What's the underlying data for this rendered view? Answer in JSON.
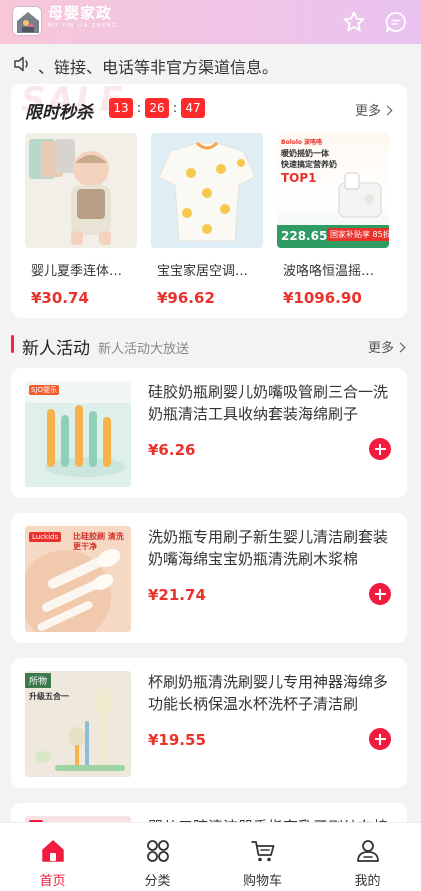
{
  "header": {
    "brand_cn": "母婴家政",
    "brand_pinyin": "MU YIN JIA ZHENG",
    "icons": [
      "star-icon",
      "message-icon"
    ]
  },
  "notice": {
    "text": "、链接、电话等非官方渠道信息。"
  },
  "flash_sale": {
    "title": "限时秒杀",
    "watermark": "SALE",
    "countdown": {
      "hours": "13",
      "minutes": "26",
      "seconds": "47"
    },
    "more_label": "更多",
    "items": [
      {
        "name": "婴儿夏季连体…",
        "price": "¥30.74"
      },
      {
        "name": "宝宝家居空调…",
        "price": "¥96.62"
      },
      {
        "name": "波咯咯恒温摇…",
        "price": "¥1096.90"
      }
    ],
    "item3_banner": {
      "brand": "Bololo 波咯咯",
      "line1": "暖奶摇奶一体",
      "line2": "快速搞定营养奶",
      "badge": "TOP1",
      "promo_price": "228.65",
      "subsidy": "国家补贴享 85折"
    }
  },
  "section": {
    "title": "新人活动",
    "subtitle": "新人活动大放送",
    "more_label": "更多"
  },
  "products": [
    {
      "title": "硅胶奶瓶刷婴儿奶嘴吸管刷三合一洗奶瓶清洁工具收纳套装海绵刷子",
      "price": "¥6.26",
      "img_tag": "SJO婴乐"
    },
    {
      "title": "洗奶瓶专用刷子新生婴儿清洁刷套装奶嘴海绵宝宝奶瓶清洗刷木浆棉",
      "price": "¥21.74",
      "img_tag": "比硅胶刷 清洗更干净",
      "img_brand": "Luckids"
    },
    {
      "title": "杯刷奶瓶清洗刷婴儿专用神器海绵多功能长柄保温水杯洗杯子清洁刷",
      "price": "¥19.55",
      "img_tag": "所物",
      "img_line": "升级五合一"
    },
    {
      "title": "婴儿口腔清洁器手指套乳牙刷纱布棉",
      "price": ""
    }
  ],
  "tabbar": [
    {
      "label": "首页",
      "icon": "home-icon",
      "active": true
    },
    {
      "label": "分类",
      "icon": "grid-icon",
      "active": false
    },
    {
      "label": "购物车",
      "icon": "cart-icon",
      "active": false
    },
    {
      "label": "我的",
      "icon": "user-icon",
      "active": false
    }
  ],
  "colors": {
    "accent": "#f01b3f",
    "price": "#e8322b",
    "header_from": "#f7c7d8",
    "header_to": "#e9c2f0"
  }
}
